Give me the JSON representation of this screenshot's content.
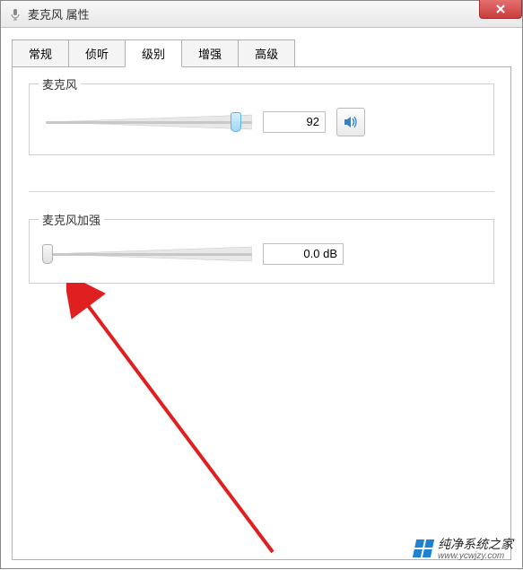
{
  "window": {
    "title": "麦克风 属性"
  },
  "tabs": {
    "items": [
      {
        "label": "常规",
        "active": false
      },
      {
        "label": "侦听",
        "active": false
      },
      {
        "label": "级别",
        "active": true
      },
      {
        "label": "增强",
        "active": false
      },
      {
        "label": "高级",
        "active": false
      }
    ]
  },
  "level_tab": {
    "mic_group": {
      "label": "麦克风",
      "value": "92",
      "slider_percent": 92
    },
    "boost_group": {
      "label": "麦克风加强",
      "value": "0.0 dB",
      "slider_percent": 0
    }
  },
  "watermark": {
    "text": "纯净系统之家",
    "url": "www.ycwjzy.com"
  }
}
